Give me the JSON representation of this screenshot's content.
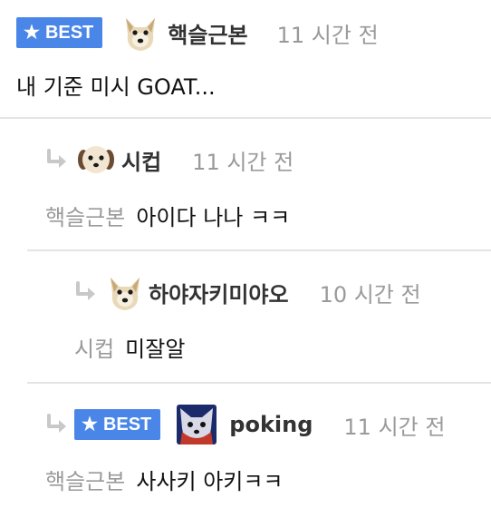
{
  "comments": [
    {
      "best": true,
      "best_label": "BEST",
      "author": "핵슬근본",
      "time": "11 시간 전",
      "mention": "",
      "text": "내 기준 미시 GOAT...",
      "is_reply": false
    },
    {
      "best": false,
      "author": "시컵",
      "time": "11 시간 전",
      "mention": "핵슬근본",
      "text": "아이다 나나 ㅋㅋ",
      "is_reply": true
    },
    {
      "best": false,
      "author": "하야자키미야오",
      "time": "10 시간 전",
      "mention": "시컵",
      "text": "미잘알",
      "is_reply": true
    },
    {
      "best": true,
      "best_label": "BEST",
      "author": "poking",
      "time": "11 시간 전",
      "mention": "핵슬근본",
      "text": "사사키 아키ㅋㅋ",
      "is_reply": true
    }
  ],
  "colors": {
    "best_badge": "#4a86e8",
    "muted_text": "#9a9a9a",
    "author_text": "#333333",
    "divider": "#e4e4e4",
    "reply_arrow": "#c8c8c8"
  },
  "icons": {
    "best_star": "star-icon",
    "reply": "reply-arrow-icon",
    "avatar_dog": "dog-avatar",
    "avatar_cat": "cat-avatar"
  }
}
